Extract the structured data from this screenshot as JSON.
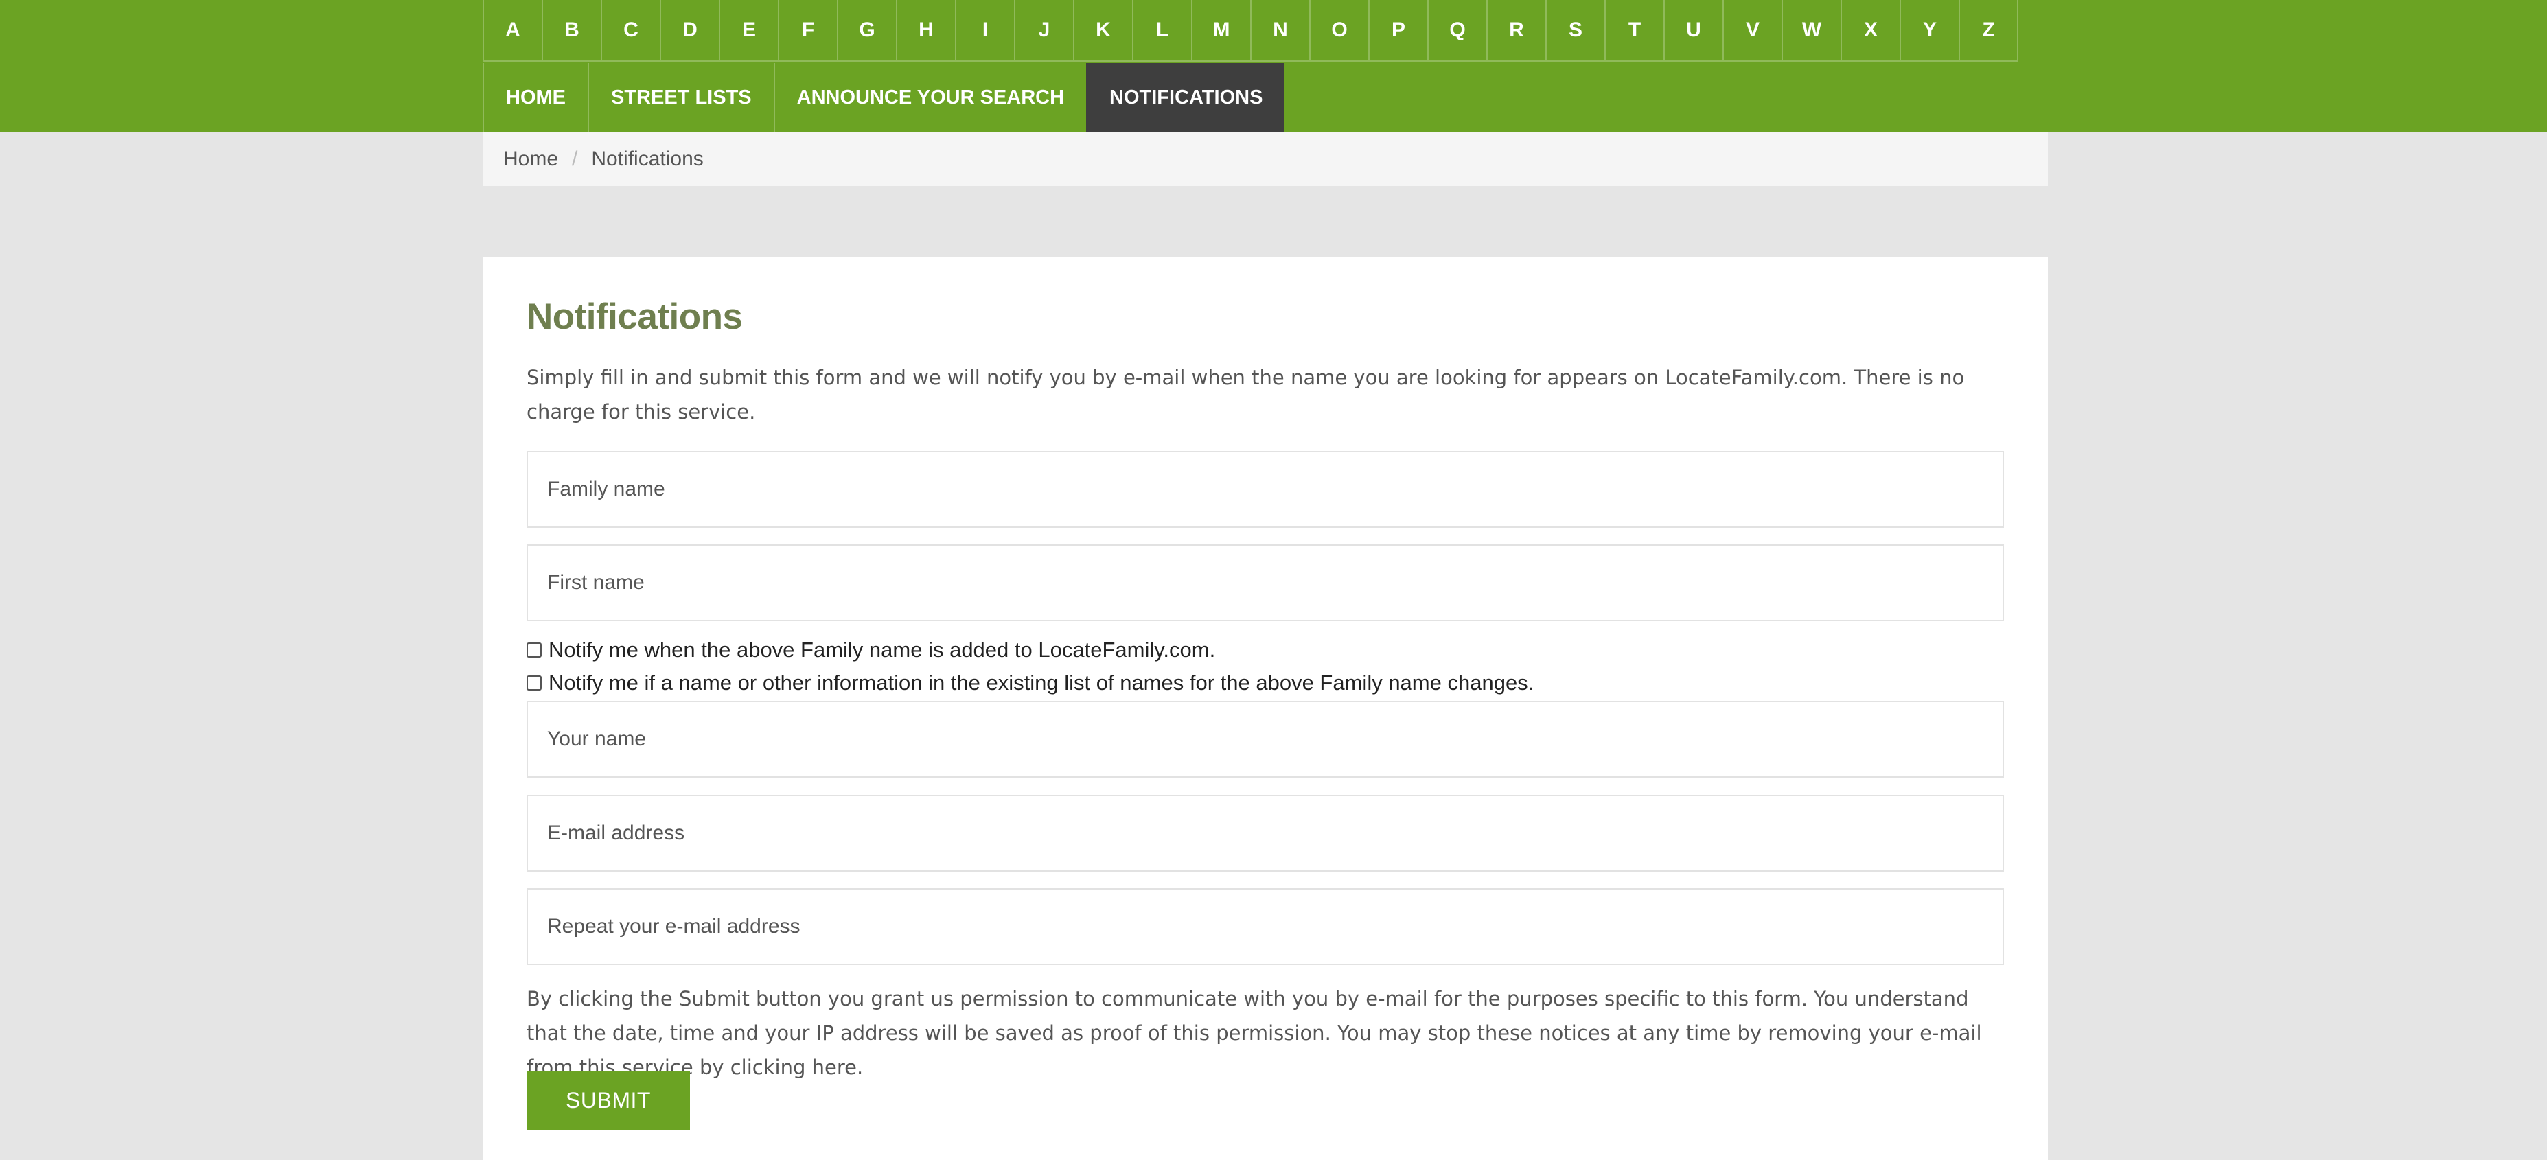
{
  "alphabet": [
    "A",
    "B",
    "C",
    "D",
    "E",
    "F",
    "G",
    "H",
    "I",
    "J",
    "K",
    "L",
    "M",
    "N",
    "O",
    "P",
    "Q",
    "R",
    "S",
    "T",
    "U",
    "V",
    "W",
    "X",
    "Y",
    "Z"
  ],
  "nav": {
    "items": [
      {
        "label": "HOME"
      },
      {
        "label": "STREET LISTS"
      },
      {
        "label": "ANNOUNCE YOUR SEARCH"
      },
      {
        "label": "NOTIFICATIONS",
        "active": true
      }
    ]
  },
  "breadcrumb": {
    "home": "Home",
    "separator": "/",
    "current": "Notifications"
  },
  "form": {
    "title": "Notifications",
    "intro": "Simply fill in and submit this form and we will notify you by e-mail when the name you are looking for appears on LocateFamily.com. There is no charge for this service.",
    "family_name_placeholder": "Family name",
    "first_name_placeholder": "First name",
    "check_added": "Notify me when the above Family name is added to LocateFamily.com.",
    "check_changes": "Notify me if a name or other information in the existing list of names for the above Family name changes.",
    "your_name_placeholder": "Your name",
    "email_placeholder": "E-mail address",
    "email_repeat_placeholder": "Repeat your e-mail address",
    "consent_text": "By clicking the Submit button you grant us permission to communicate with you by e-mail for the purposes specific to this form. You understand that the date, time and your IP address will be saved as proof of this permission. You may stop these notices at any time by removing your e-mail from this service by clicking",
    "consent_link": "here",
    "consent_end": ".",
    "submit_label": "SUBMIT"
  },
  "colors": {
    "brand_green": "#6ba323",
    "active_nav": "#3e3e3e",
    "title_color": "#6f7f4f"
  }
}
